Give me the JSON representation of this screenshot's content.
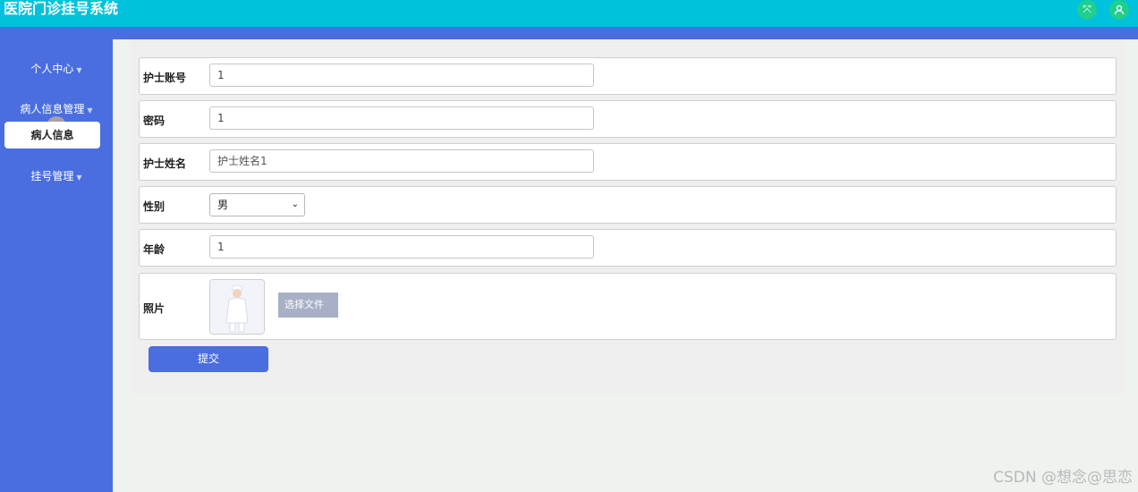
{
  "app": {
    "title": "医院门诊挂号系统"
  },
  "sidebar": {
    "items": [
      {
        "label": "个人中心"
      },
      {
        "label": "病人信息管理",
        "subitems": [
          {
            "label": "病人信息"
          }
        ]
      },
      {
        "label": "挂号管理"
      }
    ]
  },
  "form": {
    "account_label": "护士账号",
    "account_value": "1",
    "password_label": "密码",
    "password_value": "1",
    "name_label": "护士姓名",
    "name_placeholder": "护士姓名1",
    "gender_label": "性别",
    "gender_value": "男",
    "age_label": "年龄",
    "age_value": "1",
    "photo_label": "照片",
    "file_button": "选择文件",
    "submit": "提交"
  },
  "watermark": "CSDN @想念@思恋",
  "colors": {
    "header": "#00c2dc",
    "sidebar": "#4a6ee0",
    "accent": "#1fcf8e"
  }
}
